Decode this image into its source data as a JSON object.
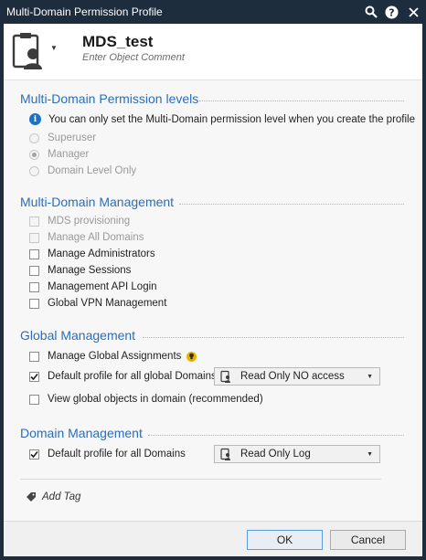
{
  "window": {
    "title": "Multi-Domain Permission Profile"
  },
  "header": {
    "name": "MDS_test",
    "comment_placeholder": "Enter Object Comment"
  },
  "permission_levels": {
    "title": "Multi-Domain Permission levels",
    "info": "You can only set the Multi-Domain permission level when you create the profile",
    "options": [
      {
        "label": "Superuser",
        "selected": false
      },
      {
        "label": "Manager",
        "selected": true
      },
      {
        "label": "Domain Level Only",
        "selected": false
      }
    ]
  },
  "md_management": {
    "title": "Multi-Domain Management",
    "items": [
      {
        "label": "MDS provisioning",
        "checked": false,
        "disabled": true
      },
      {
        "label": "Manage All Domains",
        "checked": false,
        "disabled": true
      },
      {
        "label": "Manage Administrators",
        "checked": false,
        "disabled": false
      },
      {
        "label": "Manage Sessions",
        "checked": false,
        "disabled": false
      },
      {
        "label": "Management API Login",
        "checked": false,
        "disabled": false
      },
      {
        "label": "Global VPN Management",
        "checked": false,
        "disabled": false
      }
    ]
  },
  "global_management": {
    "title": "Global Management",
    "manage_assignments": "Manage Global Assignments",
    "default_profile": "Default profile for all global Domains",
    "default_profile_value": "Read Only NO access",
    "view_global": "View global objects in domain (recommended)"
  },
  "domain_management": {
    "title": "Domain Management",
    "default_profile": "Default profile for all Domains",
    "default_profile_value": "Read Only Log"
  },
  "add_tag": "Add Tag",
  "buttons": {
    "ok": "OK",
    "cancel": "Cancel"
  }
}
